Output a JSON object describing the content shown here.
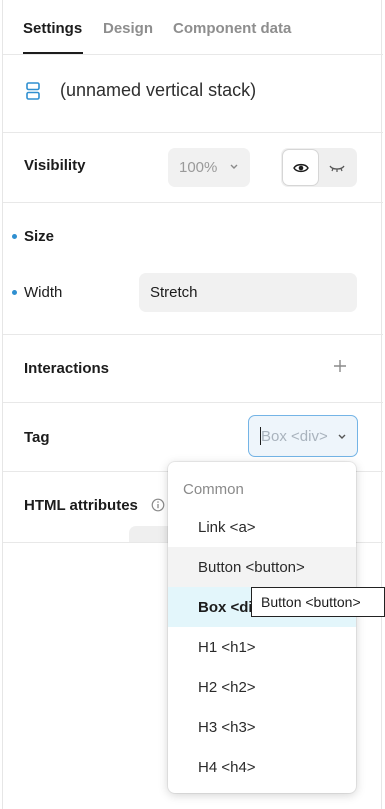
{
  "tabs": [
    {
      "label": "Settings",
      "active": true
    },
    {
      "label": "Design",
      "active": false
    },
    {
      "label": "Component data",
      "active": false
    }
  ],
  "element": {
    "name": "(unnamed vertical stack)",
    "icon": "vertical-stack-icon"
  },
  "visibility": {
    "label": "Visibility",
    "opacity": "100%",
    "visible": true
  },
  "size": {
    "label": "Size",
    "width_label": "Width",
    "width_value": "Stretch",
    "indicator_color": "#2f8fd0"
  },
  "interactions": {
    "label": "Interactions"
  },
  "tag": {
    "label": "Tag",
    "value": "Box <div>"
  },
  "html_attributes": {
    "label": "HTML attributes"
  },
  "dropdown": {
    "header": "Common",
    "items": [
      {
        "label": "Link <a>",
        "state": "normal"
      },
      {
        "label": "Button <button>",
        "state": "hover"
      },
      {
        "label": "Box <div>",
        "state": "selected"
      },
      {
        "label": "H1 <h1>",
        "state": "normal"
      },
      {
        "label": "H2 <h2>",
        "state": "normal"
      },
      {
        "label": "H3 <h3>",
        "state": "normal"
      },
      {
        "label": "H4 <h4>",
        "state": "normal"
      }
    ]
  },
  "tooltip": {
    "text": "Button <button>"
  },
  "colors": {
    "accent": "#2f8fd0",
    "selected_bg": "#e3f6fb",
    "focus_border": "#74b4e6"
  }
}
